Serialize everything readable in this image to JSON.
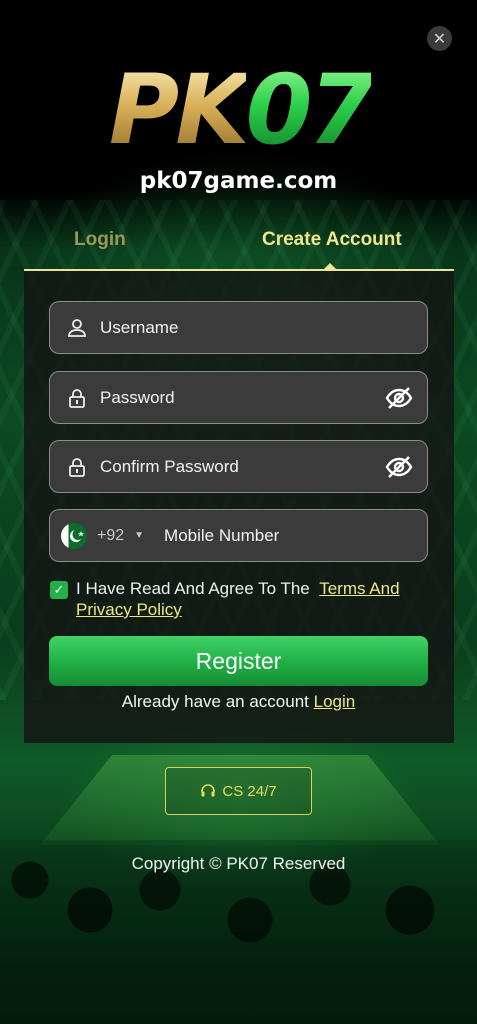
{
  "logo": {
    "part1": "PK",
    "part2": "07"
  },
  "site_url": "pk07game.com",
  "tabs": {
    "login": "Login",
    "create": "Create Account"
  },
  "form": {
    "username_placeholder": "Username",
    "password_placeholder": "Password",
    "confirm_placeholder": "Confirm Password",
    "country_code": "+92",
    "mobile_placeholder": "Mobile Number"
  },
  "agree": {
    "text": "I Have Read And Agree To The",
    "link": "Terms And Privacy Policy",
    "checked": true
  },
  "register_label": "Register",
  "already": {
    "text": "Already have an account",
    "link": "Login"
  },
  "cs_label": "CS 24/7",
  "copyright": "Copyright © PK07 Reserved",
  "colors": {
    "accent_gold": "#efe78a",
    "button_green": "#1fae45",
    "flag_green": "#0d6b2b"
  }
}
